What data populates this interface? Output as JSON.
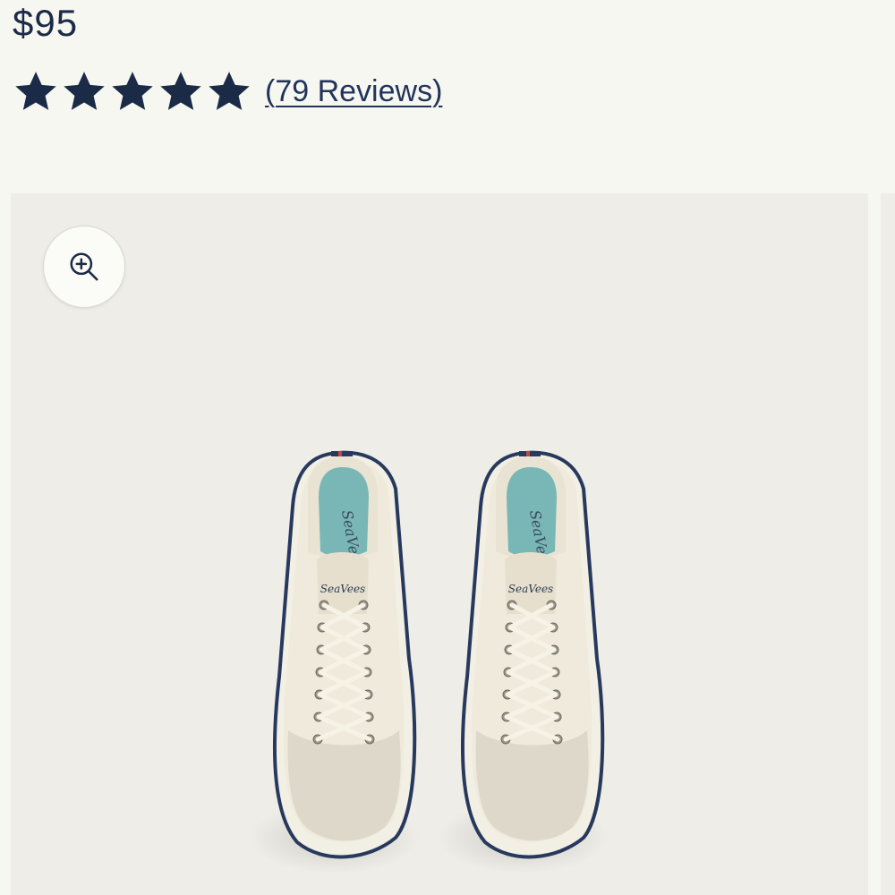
{
  "product": {
    "price": "$95",
    "rating": {
      "stars": 5,
      "max_stars": 5,
      "reviews_label": "(79 Reviews)"
    }
  },
  "gallery": {
    "zoom_icon": "zoom-in-icon",
    "image_brand_text": "SeaVees"
  },
  "colors": {
    "navy": "#1b2a47",
    "background": "#f7f7f2",
    "gallery_bg": "#eeede7"
  }
}
